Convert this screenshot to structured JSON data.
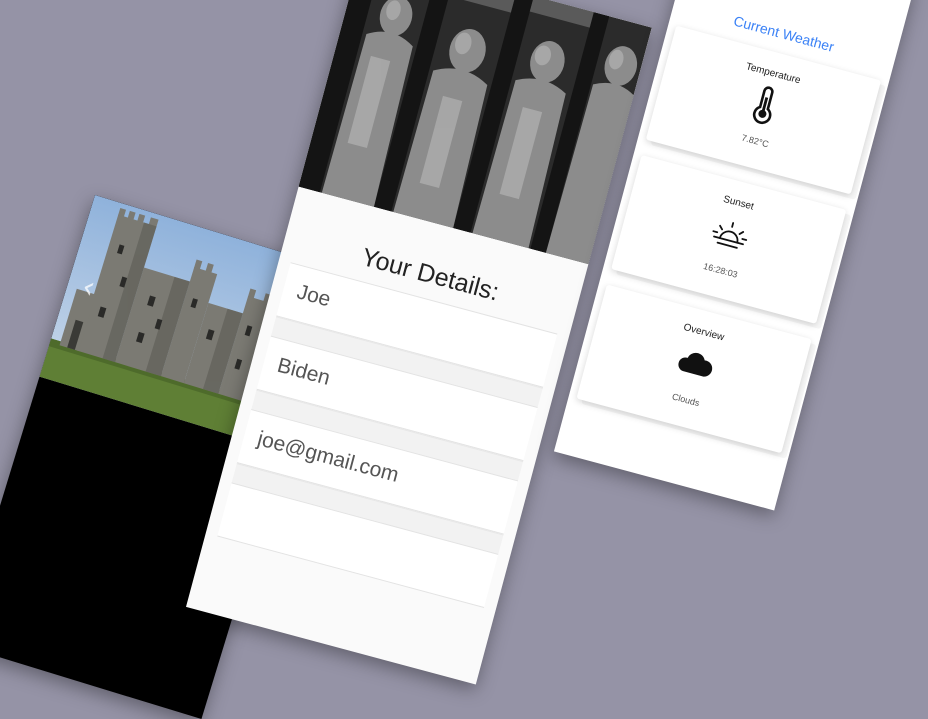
{
  "castle_gallery": {
    "image": "castle-photo",
    "prev_icon": "chevron-left-icon"
  },
  "details": {
    "title": "Your Details:",
    "fields": [
      {
        "name": "first-name",
        "value": "Joe"
      },
      {
        "name": "last-name",
        "value": "Biden"
      },
      {
        "name": "email",
        "value": "joe@gmail.com"
      }
    ]
  },
  "weather": {
    "title": "Current Weather",
    "accent_color": "#3b82f6",
    "cards": [
      {
        "label": "Temperature",
        "icon": "thermometer-icon",
        "value": "7.82°C"
      },
      {
        "label": "Sunset",
        "icon": "sunset-icon",
        "value": "16:28:03"
      },
      {
        "label": "Overview",
        "icon": "cloud-icon",
        "value": "Clouds"
      }
    ]
  }
}
